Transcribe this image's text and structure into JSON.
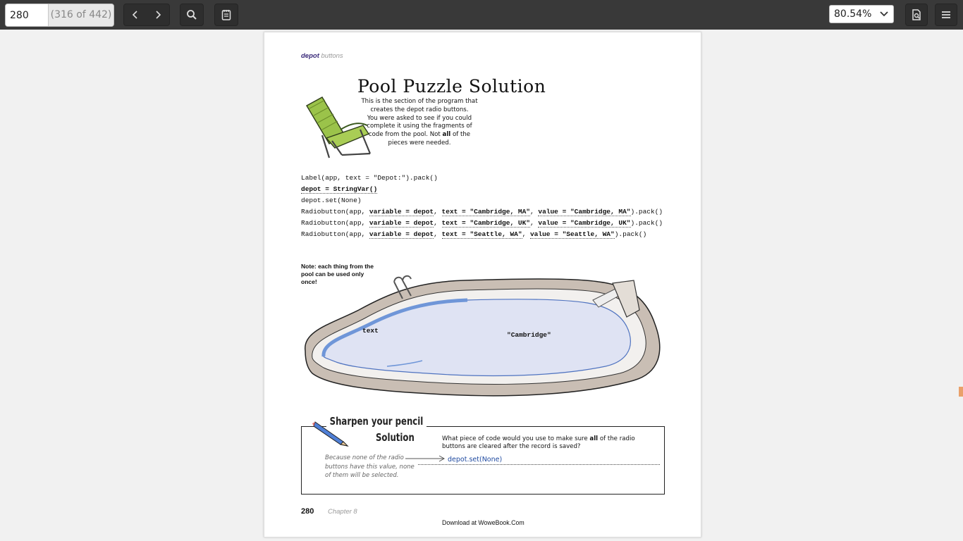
{
  "toolbar": {
    "page_value": "280",
    "page_count": "(316 of 442)",
    "zoom_value": "80.54%",
    "icons": [
      "chevron-left-icon",
      "chevron-right-icon",
      "search-icon",
      "notes-icon",
      "chevron-down-icon",
      "document-properties-icon",
      "menu-icon"
    ]
  },
  "document": {
    "header_bold": "depot",
    "header_rest": " buttons",
    "title": "Pool Puzzle Solution",
    "intro_lines": [
      "This is the section of the program that",
      "creates the depot radio buttons.",
      "You were asked to see if you could",
      "complete it using the fragments of",
      "code from the pool. Not",
      "all",
      "of the",
      "pieces were needed."
    ],
    "code": {
      "line1": "Label(app, text = \"Depot:\").pack()",
      "line2": "depot = StringVar()",
      "line3": "depot.set(None)",
      "rb_prefix": "Radiobutton(app, ",
      "var_frag": "variable = depot",
      "sep": ", ",
      "text1": "text = \"Cambridge, MA\"",
      "val1": "value = \"Cambridge, MA\"",
      "text2": "text = \"Cambridge, UK\"",
      "val2": "value = \"Cambridge, UK\"",
      "text3": "text = \"Seattle, WA\"",
      "val3": "value = \"Seattle, WA\"",
      "suffix": ").pack()"
    },
    "note": "Note: each thing from the pool can be used only once!",
    "pool_words": [
      "text",
      "\"Cambridge\""
    ],
    "sharpen_title": "Sharpen your pencil",
    "sharpen_subtitle": "Solution",
    "question_part1": "What piece of code would you use to make sure",
    "question_bold": "all",
    "question_part2": "of the radio buttons are cleared after the record is saved?",
    "hand_note": "Because none of the radio buttons have this value, none of them will be selected.",
    "answer": "depot.set(None)",
    "page_number": "280",
    "chapter": "Chapter 8",
    "download": "Download at WoweBook.Com"
  },
  "colors": {
    "toolbar_bg": "#393939",
    "viewer_bg": "#f1f1f1",
    "answer_blue": "#1f4aa0",
    "side_marker": "#e9a06a"
  }
}
